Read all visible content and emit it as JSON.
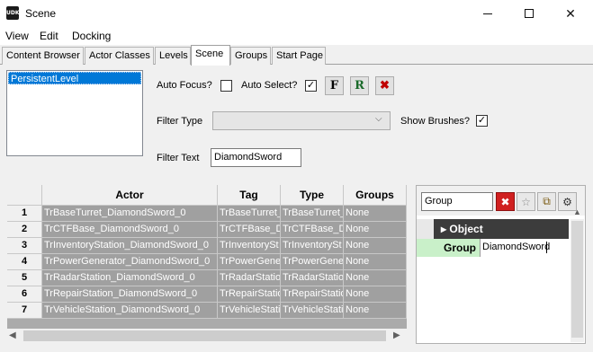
{
  "window": {
    "title": "Scene",
    "icon_text": "UDK",
    "minimize": "—",
    "maximize": "□",
    "close": "✕"
  },
  "menu": [
    "View",
    "Edit",
    "Docking"
  ],
  "tabs": [
    {
      "label": "Content Browser",
      "active": false
    },
    {
      "label": "Actor Classes",
      "active": false
    },
    {
      "label": "Levels",
      "active": false
    },
    {
      "label": "Scene",
      "active": true
    },
    {
      "label": "Groups",
      "active": false
    },
    {
      "label": "Start Page",
      "active": false
    }
  ],
  "levels": [
    "PersistentLevel"
  ],
  "controls": {
    "auto_focus_label": "Auto Focus?",
    "auto_focus_checked": false,
    "auto_select_label": "Auto Select?",
    "auto_select_checked": true,
    "check_glyph": "✓",
    "focus_button": "F",
    "refresh_button": "R",
    "delete_button": "✖",
    "filter_type_label": "Filter Type",
    "filter_type_value": "",
    "dropdown_arrow": "⌵",
    "show_brushes_label": "Show Brushes?",
    "show_brushes_checked": true,
    "filter_text_label": "Filter Text",
    "filter_text_value": "DiamondSword"
  },
  "grid": {
    "columns": [
      "Actor",
      "Tag",
      "Type",
      "Groups"
    ],
    "rows": [
      {
        "num": "1",
        "actor": "TrBaseTurret_DiamondSword_0",
        "tag": "TrBaseTurret_",
        "type": "TrBaseTurret_",
        "groups": "None"
      },
      {
        "num": "2",
        "actor": "TrCTFBase_DiamondSword_0",
        "tag": "TrCTFBase_Di",
        "type": "TrCTFBase_Di",
        "groups": "None"
      },
      {
        "num": "3",
        "actor": "TrInventoryStation_DiamondSword_0",
        "tag": "TrInventorySt",
        "type": "TrInventorySt",
        "groups": "None"
      },
      {
        "num": "4",
        "actor": "TrPowerGenerator_DiamondSword_0",
        "tag": "TrPowerGene",
        "type": "TrPowerGene",
        "groups": "None"
      },
      {
        "num": "5",
        "actor": "TrRadarStation_DiamondSword_0",
        "tag": "TrRadarStatio",
        "type": "TrRadarStatio",
        "groups": "None"
      },
      {
        "num": "6",
        "actor": "TrRepairStation_DiamondSword_0",
        "tag": "TrRepairStatio",
        "type": "TrRepairStatio",
        "groups": "None"
      },
      {
        "num": "7",
        "actor": "TrVehicleStation_DiamondSword_0",
        "tag": "TrVehicleStati",
        "type": "TrVehicleStati",
        "groups": "None"
      }
    ],
    "scroll_left": "◀",
    "scroll_right": "▶"
  },
  "properties": {
    "search_value": "Group",
    "category": "Object",
    "category_arrow": "▸",
    "field_label": "Group",
    "field_value": "DiamondSword",
    "scroll_up": "▲",
    "btn_clear": "✖",
    "btn_star": "☆",
    "btn_copy": "⧉",
    "btn_tool": "⚙"
  },
  "colors": {
    "selection": "#0078d7",
    "grid_row_bg": "#a0a0a0",
    "property_label_bg": "#c9f0c9",
    "category_bg": "#3c3c3c"
  }
}
